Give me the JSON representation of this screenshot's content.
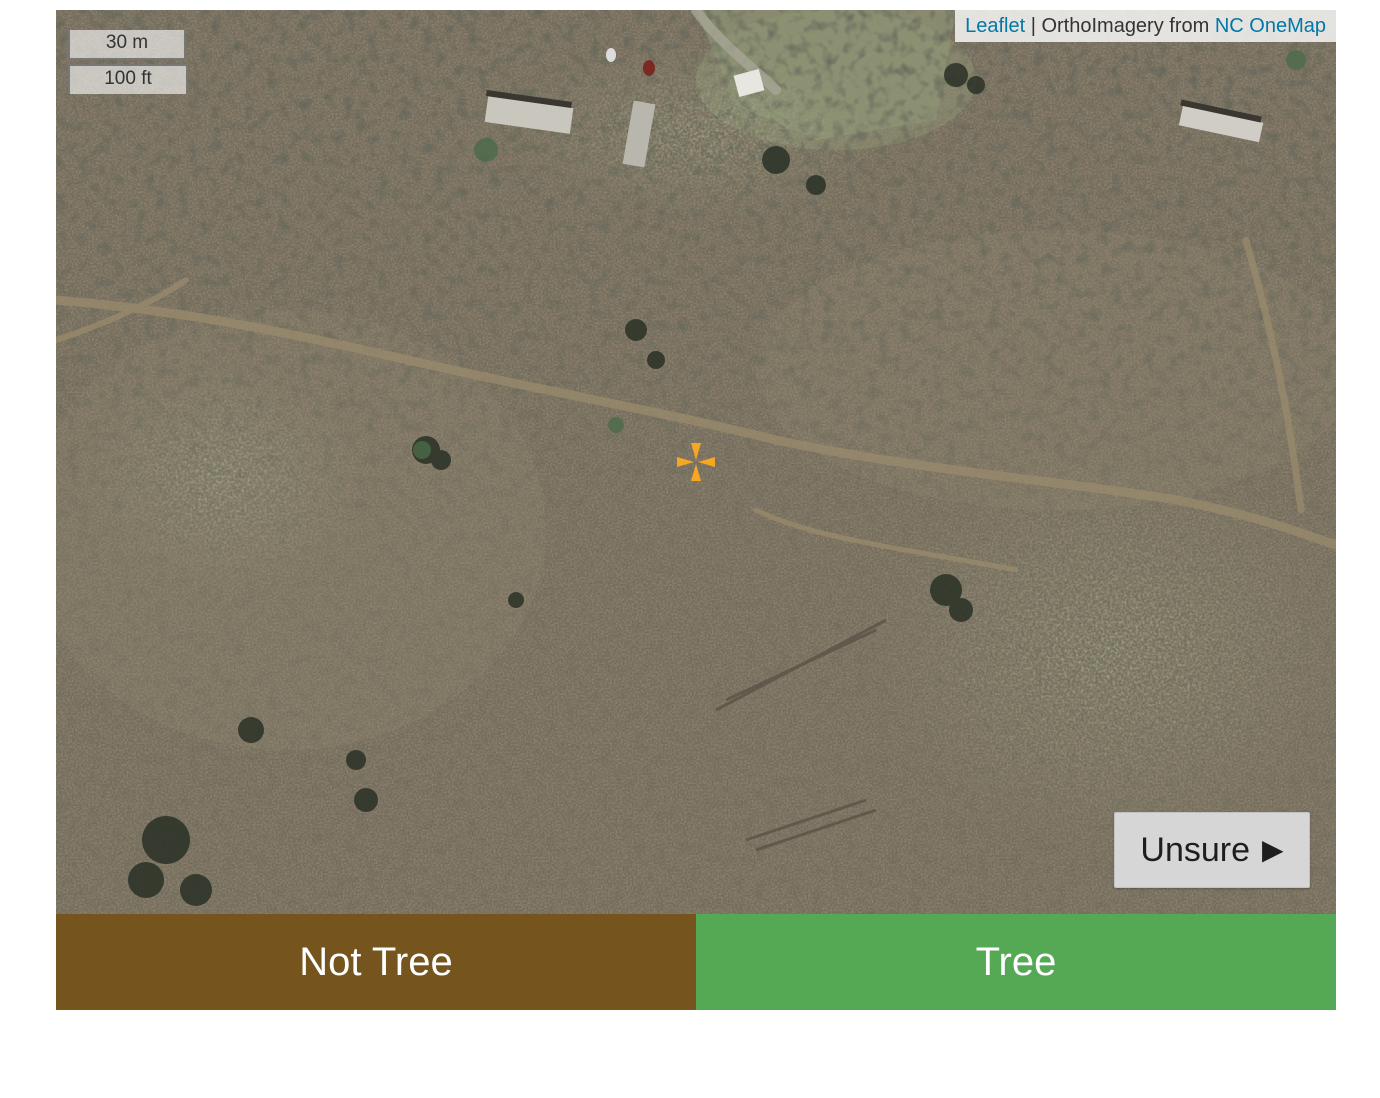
{
  "map": {
    "scale": {
      "metric": "30 m",
      "imperial": "100 ft"
    },
    "attribution": {
      "leaflet_link": "Leaflet",
      "separator": " | ",
      "text": "OrthoImagery from ",
      "source_link": "NC OneMap"
    },
    "crosshair_color": "#F5A623",
    "crosshair_icon": "crosshair-icon"
  },
  "controls": {
    "unsure_label": "Unsure",
    "unsure_arrow": "▶",
    "not_tree_label": "Not Tree",
    "tree_label": "Tree"
  },
  "colors": {
    "not_tree": "#76541E",
    "tree": "#55A954",
    "unsure_bg": "#D6D6D6",
    "link": "#0078A8"
  }
}
